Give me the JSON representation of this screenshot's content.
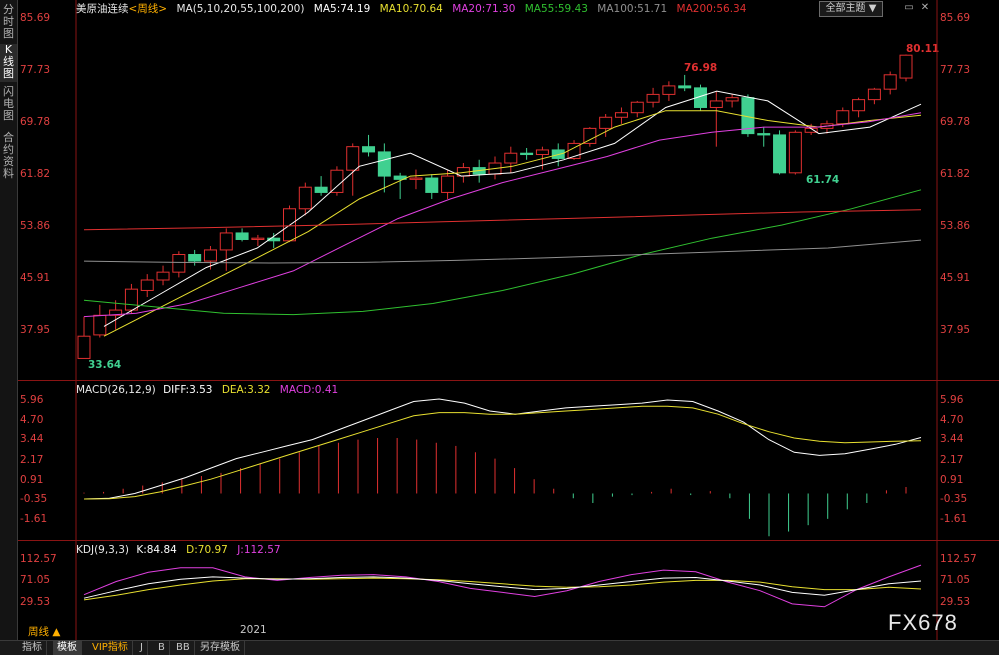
{
  "sidebar": {
    "tabs": [
      {
        "label": "分时图",
        "active": false
      },
      {
        "label": "K线图",
        "active": true
      },
      {
        "label": "闪电图",
        "active": false
      },
      {
        "label": "合约资料",
        "active": false
      }
    ]
  },
  "main_panel": {
    "symbol": "美原油连续",
    "period_tag": "<周线>",
    "ma_label": "MA(5,10,20,55,100,200)",
    "ma_values": [
      {
        "label": "MA5:74.19",
        "color": "#ffffff"
      },
      {
        "label": "MA10:70.64",
        "color": "#e8e030"
      },
      {
        "label": "MA20:71.30",
        "color": "#e040e0"
      },
      {
        "label": "MA55:59.43",
        "color": "#30c030"
      },
      {
        "label": "MA100:51.71",
        "color": "#909090"
      },
      {
        "label": "MA200:56.34",
        "color": "#e03030"
      }
    ],
    "y_ticks": [
      "85.69",
      "77.73",
      "69.78",
      "61.82",
      "53.86",
      "45.91",
      "37.95"
    ],
    "annotations": {
      "high": "76.98",
      "low_mid": "61.74",
      "low_start": "33.64",
      "last_high": "80.11"
    }
  },
  "macd_panel": {
    "label": "MACD(26,12,9)",
    "diff": "DIFF:3.53",
    "dea": "DEA:3.32",
    "macd": "MACD:0.41",
    "y_ticks": [
      "5.96",
      "4.70",
      "3.44",
      "2.17",
      "0.91",
      "-0.35",
      "-1.61"
    ]
  },
  "kdj_panel": {
    "label": "KDJ(9,3,3)",
    "k": "K:84.84",
    "d": "D:70.97",
    "j": "J:112.57",
    "y_ticks": [
      "112.57",
      "71.05",
      "29.53"
    ]
  },
  "toolbar": {
    "theme_button": "全部主题 ▼",
    "period_label": "周线 ▲",
    "date_label": "2021"
  },
  "bottom_tabs": [
    "指标",
    "模板",
    "VIP指标",
    "J",
    "B",
    "BB",
    "另存模板"
  ],
  "watermark": "FX678",
  "colors": {
    "up": "#e03030",
    "down": "#40d090",
    "axis": "#e04040",
    "grid": "#8a1414"
  },
  "chart_data": {
    "type": "candlestick",
    "title": "美原油连续<周线>",
    "series": [
      {
        "name": "OHLC",
        "values": [
          [
            33.6,
            40.0,
            33.6,
            37.0
          ],
          [
            37.2,
            41.8,
            36.8,
            40.2
          ],
          [
            40.2,
            42.5,
            38.0,
            41.0
          ],
          [
            41.0,
            45.0,
            40.5,
            44.2
          ],
          [
            44.0,
            46.5,
            43.0,
            45.6
          ],
          [
            45.6,
            47.8,
            44.8,
            46.8
          ],
          [
            46.8,
            50.0,
            46.0,
            49.5
          ],
          [
            49.5,
            50.2,
            47.8,
            48.5
          ],
          [
            48.5,
            50.8,
            47.2,
            50.2
          ],
          [
            50.2,
            53.5,
            47.0,
            52.8
          ],
          [
            52.8,
            53.5,
            51.5,
            51.8
          ],
          [
            51.8,
            52.5,
            50.8,
            52.0
          ],
          [
            52.0,
            52.8,
            50.5,
            51.6
          ],
          [
            51.6,
            57.0,
            51.4,
            56.5
          ],
          [
            56.5,
            60.5,
            55.5,
            59.8
          ],
          [
            59.8,
            61.5,
            58.5,
            59.0
          ],
          [
            59.0,
            63.0,
            58.5,
            62.4
          ],
          [
            62.4,
            66.5,
            58.5,
            66.0
          ],
          [
            66.0,
            67.8,
            64.5,
            65.2
          ],
          [
            65.2,
            66.5,
            59.0,
            61.5
          ],
          [
            61.5,
            62.0,
            58.0,
            61.0
          ],
          [
            61.0,
            62.5,
            59.5,
            61.2
          ],
          [
            61.2,
            61.8,
            58.0,
            59.0
          ],
          [
            59.0,
            62.5,
            58.0,
            61.5
          ],
          [
            61.5,
            63.5,
            60.5,
            62.8
          ],
          [
            62.8,
            64.0,
            60.5,
            61.8
          ],
          [
            61.8,
            64.5,
            61.0,
            63.5
          ],
          [
            63.5,
            66.0,
            62.0,
            65.0
          ],
          [
            65.0,
            65.8,
            64.0,
            64.8
          ],
          [
            64.8,
            66.0,
            62.5,
            65.5
          ],
          [
            65.5,
            66.5,
            63.0,
            64.2
          ],
          [
            64.2,
            67.0,
            64.0,
            66.5
          ],
          [
            66.5,
            69.0,
            66.0,
            68.8
          ],
          [
            68.8,
            71.0,
            67.5,
            70.5
          ],
          [
            70.5,
            72.0,
            69.5,
            71.2
          ],
          [
            71.2,
            73.0,
            70.5,
            72.8
          ],
          [
            72.8,
            75.0,
            72.0,
            74.0
          ],
          [
            74.0,
            76.0,
            73.0,
            75.3
          ],
          [
            75.3,
            76.98,
            74.5,
            75.0
          ],
          [
            75.0,
            75.5,
            71.5,
            72.0
          ],
          [
            72.0,
            74.5,
            66.0,
            73.0
          ],
          [
            73.0,
            74.0,
            72.0,
            73.5
          ],
          [
            73.5,
            74.0,
            67.5,
            68.0
          ],
          [
            68.0,
            69.0,
            66.0,
            67.8
          ],
          [
            67.8,
            68.5,
            61.74,
            62.0
          ],
          [
            62.0,
            68.5,
            61.74,
            68.2
          ],
          [
            68.2,
            69.5,
            67.8,
            68.8
          ],
          [
            68.8,
            70.0,
            68.0,
            69.5
          ],
          [
            69.5,
            72.0,
            69.0,
            71.5
          ],
          [
            71.5,
            73.5,
            70.5,
            73.2
          ],
          [
            73.2,
            75.0,
            72.5,
            74.8
          ],
          [
            74.8,
            77.5,
            74.0,
            77.0
          ],
          [
            76.5,
            80.11,
            76.0,
            80.0
          ]
        ]
      }
    ],
    "moving_averages": [
      {
        "name": "MA5",
        "values": [
          38.5,
          43.0,
          47.5,
          50.5,
          56.0,
          63.0,
          65.0,
          61.5,
          62.0,
          64.0,
          66.5,
          72.0,
          74.5,
          73.0,
          68.0,
          69.0,
          72.5
        ]
      },
      {
        "name": "MA10",
        "values": [
          37.0,
          41.0,
          45.0,
          49.0,
          53.0,
          58.0,
          61.5,
          62.0,
          63.0,
          65.0,
          69.0,
          71.5,
          71.5,
          70.0,
          69.0,
          70.0,
          70.8
        ]
      },
      {
        "name": "MA20",
        "values": [
          40.0,
          40.5,
          42.0,
          44.5,
          47.0,
          51.0,
          55.0,
          58.0,
          60.5,
          62.5,
          64.5,
          67.0,
          68.2,
          69.0,
          69.0,
          69.8,
          71.2
        ]
      },
      {
        "name": "MA55",
        "values": [
          42.5,
          41.5,
          40.5,
          40.3,
          40.8,
          42.0,
          44.0,
          46.5,
          49.5,
          52.0,
          54.0,
          56.5,
          59.4
        ]
      },
      {
        "name": "MA100",
        "values": [
          48.5,
          48.3,
          48.2,
          48.3,
          48.6,
          49.0,
          49.5,
          50.0,
          50.5,
          51.7
        ]
      },
      {
        "name": "MA200",
        "values": [
          53.3,
          53.6,
          54.0,
          54.5,
          55.0,
          55.5,
          56.0,
          56.34
        ]
      }
    ],
    "ylim": [
      33.0,
      86.0
    ],
    "yticks": [
      85.69,
      77.73,
      69.78,
      61.82,
      53.86,
      45.91,
      37.95
    ],
    "macd": {
      "diff": [
        -0.35,
        -0.3,
        0.0,
        0.5,
        1.0,
        1.6,
        2.2,
        2.6,
        3.0,
        3.4,
        4.0,
        4.6,
        5.2,
        5.8,
        5.96,
        5.7,
        5.2,
        5.0,
        5.2,
        5.4,
        5.5,
        5.6,
        5.7,
        5.9,
        5.8,
        5.2,
        4.5,
        3.4,
        2.6,
        2.4,
        2.5,
        2.8,
        3.1,
        3.53
      ],
      "dea": [
        -0.35,
        -0.33,
        -0.2,
        0.1,
        0.5,
        0.9,
        1.4,
        1.9,
        2.4,
        2.9,
        3.4,
        3.9,
        4.4,
        4.9,
        5.1,
        5.1,
        5.0,
        5.0,
        5.1,
        5.2,
        5.3,
        5.4,
        5.5,
        5.5,
        5.4,
        5.0,
        4.4,
        3.9,
        3.5,
        3.3,
        3.2,
        3.25,
        3.3,
        3.32
      ],
      "hist": [
        0.05,
        0.1,
        0.3,
        0.5,
        0.7,
        0.9,
        1.1,
        1.3,
        1.6,
        1.9,
        2.2,
        2.6,
        3.0,
        3.2,
        3.4,
        3.5,
        3.5,
        3.4,
        3.2,
        3.0,
        2.6,
        2.2,
        1.6,
        0.9,
        0.3,
        -0.3,
        -0.6,
        -0.2,
        -0.1,
        0.1,
        0.3,
        -0.1,
        0.15,
        -0.3,
        -1.6,
        -2.7,
        -2.4,
        -2.0,
        -1.6,
        -1.0,
        -0.6,
        0.2,
        0.41
      ]
    },
    "kdj": {
      "k": [
        55,
        68,
        80,
        88,
        92,
        90,
        88,
        89,
        91,
        92,
        90,
        86,
        80,
        75,
        70,
        72,
        78,
        84,
        90,
        91,
        85,
        78,
        65,
        60,
        70,
        80,
        84.84
      ],
      "d": [
        52,
        60,
        70,
        78,
        85,
        89,
        89,
        88,
        89,
        90,
        89,
        87,
        84,
        80,
        76,
        74,
        75,
        78,
        83,
        86,
        86,
        83,
        75,
        70,
        70,
        74,
        70.97
      ],
      "j": [
        61,
        84,
        100,
        108,
        108,
        92,
        86,
        91,
        95,
        96,
        92,
        84,
        72,
        65,
        58,
        68,
        84,
        96,
        104,
        101,
        83,
        68,
        45,
        40,
        70,
        92,
        112.57
      ],
      "ylim": [
        10,
        125
      ]
    }
  }
}
